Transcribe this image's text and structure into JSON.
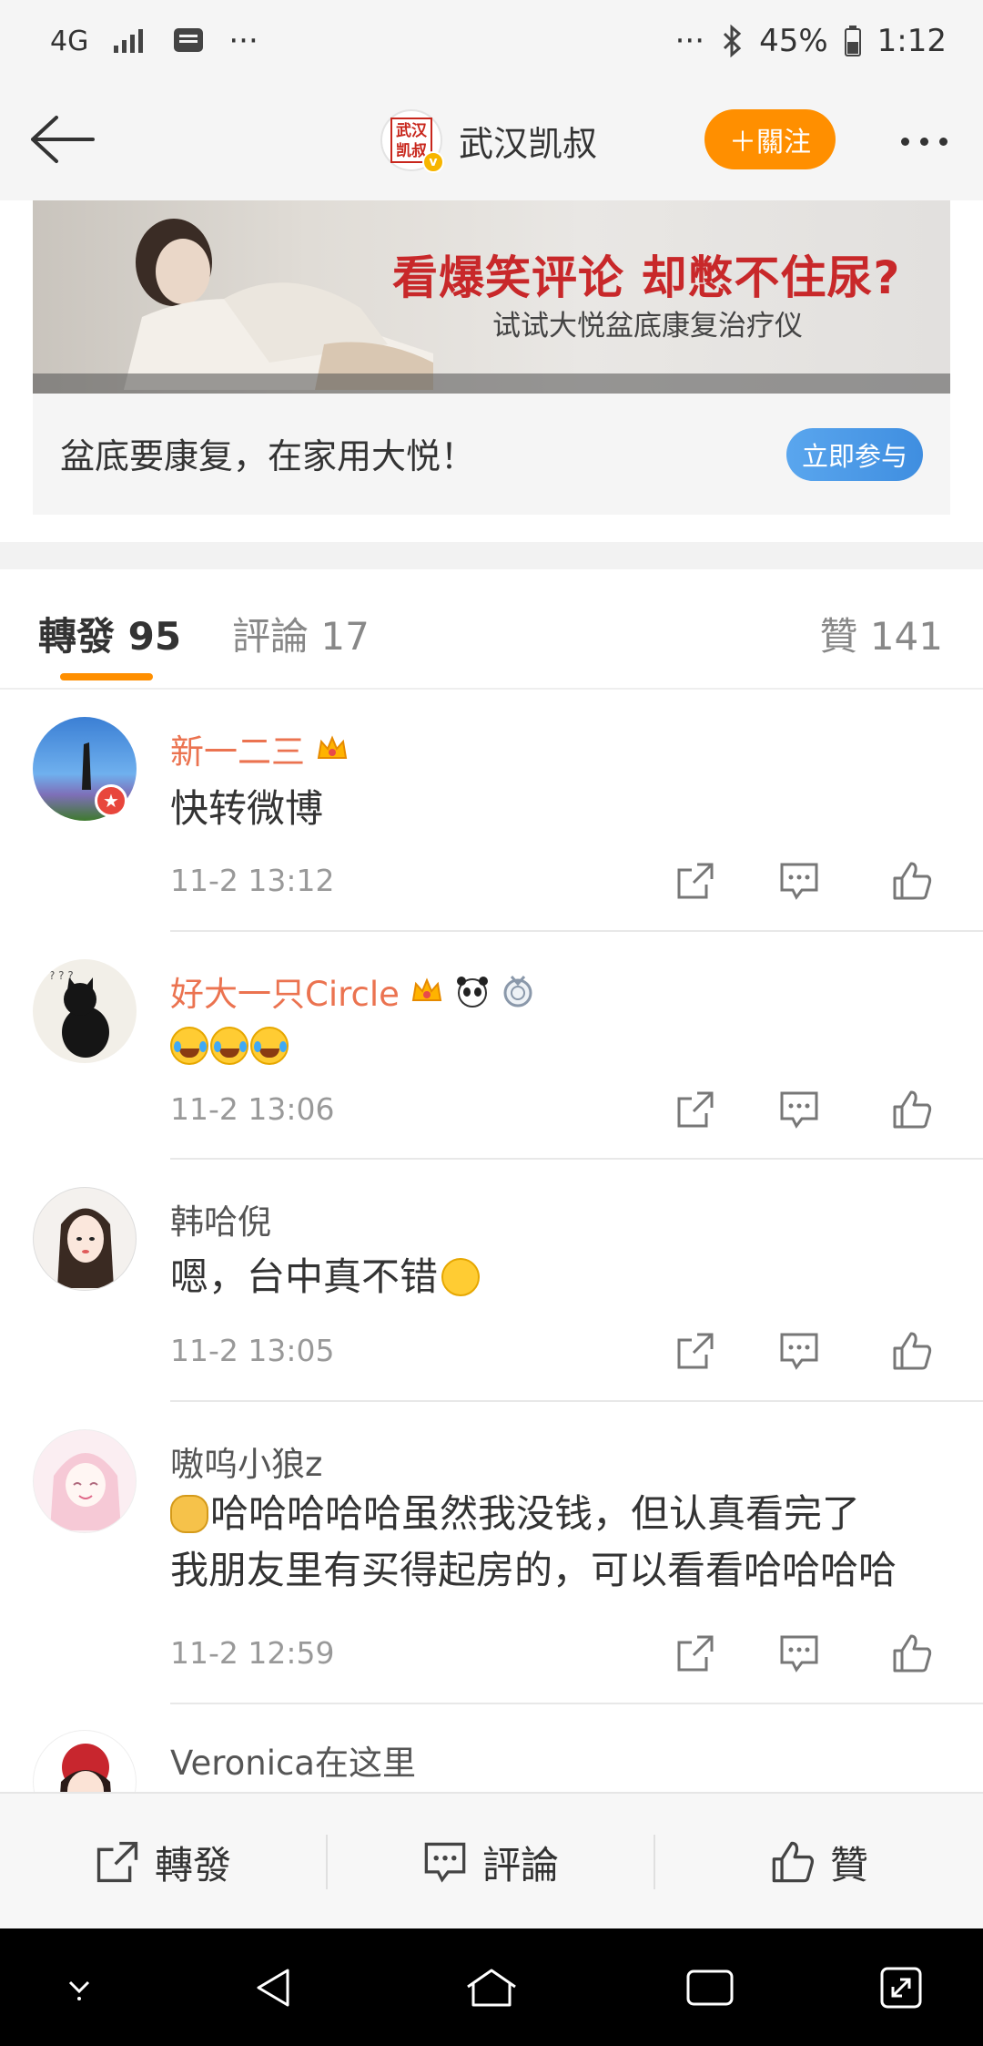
{
  "status_bar": {
    "network": "4G",
    "dots_left": "···",
    "dots_right": "···",
    "battery": "45%",
    "time": "1:12"
  },
  "header": {
    "title": "武汉凯叔",
    "logo_text": "武汉凯叔",
    "follow_label": "＋關注"
  },
  "ad": {
    "headline": "看爆笑评论 却憋不住尿?",
    "subheadline": "试试大悦盆底康复治疗仪",
    "tagline": "盆底要康复，在家用大悦！",
    "button_label": "立即参与"
  },
  "tabs": {
    "forward": "轉發 95",
    "comment": "評論 17",
    "like": "贊 141"
  },
  "reposts": [
    {
      "user": "新一二三",
      "content": "快转微博",
      "time": "11-2 13:12"
    },
    {
      "user": "好大一只Circle",
      "content": "",
      "time": "11-2 13:06"
    },
    {
      "user": "韩哈倪",
      "content": "嗯，台中真不错",
      "time": "11-2 13:05"
    },
    {
      "user": "嗷呜小狼z",
      "content_line1": "哈哈哈哈哈虽然我没钱，但认真看完了",
      "content_line2": "我朋友里有买得起房的，可以看看哈哈哈哈",
      "time": "11-2 12:59"
    },
    {
      "user": "Veronica在这里"
    }
  ],
  "bottom_bar": {
    "forward": "轉發",
    "comment": "評論",
    "like": "贊"
  },
  "colors": {
    "accent": "#ff8f00",
    "username_vip": "#eb7350",
    "ad_button": "#4a98e8"
  }
}
